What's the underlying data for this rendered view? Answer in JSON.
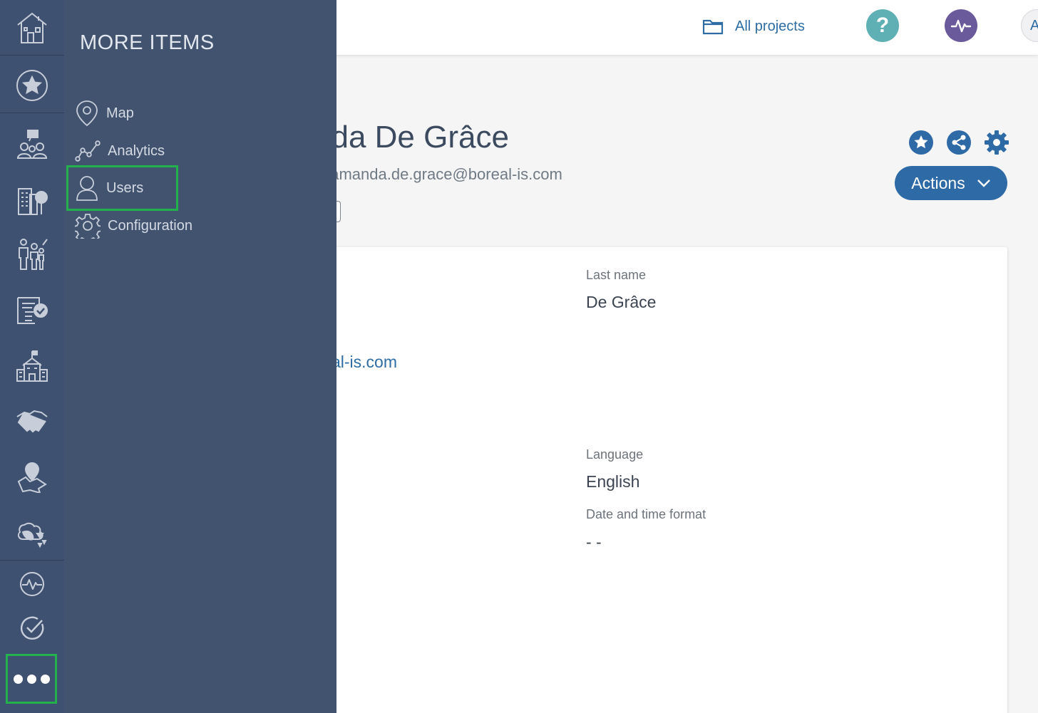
{
  "header": {
    "all_projects_label": "All projects",
    "help_symbol": "?",
    "avatar_initial": "A",
    "help_color": "#5fb0b4",
    "activity_color": "#6b5a9b"
  },
  "rail": {
    "items": [
      {
        "icon": "home-icon"
      },
      {
        "icon": "star-icon"
      },
      {
        "icon": "stakeholders-icon"
      },
      {
        "icon": "buildings-tree-icon"
      },
      {
        "icon": "family-icon"
      },
      {
        "icon": "checklist-icon"
      },
      {
        "icon": "school-icon"
      },
      {
        "icon": "handshake-icon"
      },
      {
        "icon": "land-pin-icon"
      },
      {
        "icon": "environment-icon"
      },
      {
        "icon": "activity-icon"
      },
      {
        "icon": "check-circle-icon"
      }
    ],
    "more_icon": "more-dots-icon",
    "background": "#3f5170"
  },
  "flyout": {
    "title": "MORE ITEMS",
    "items": [
      {
        "label": "Map",
        "icon": "map-pin-icon"
      },
      {
        "label": "Analytics",
        "icon": "analytics-icon"
      },
      {
        "label": "Users",
        "icon": "user-icon"
      },
      {
        "label": "Configuration",
        "icon": "gear-icon"
      }
    ],
    "background": "#42536f"
  },
  "profile": {
    "title_visible": "nda De Grâce",
    "subtitle_visible": "ceamanda.de.grace@boreal-is.com",
    "actions_label": "Actions",
    "accent_color": "#2e6aa5"
  },
  "details": {
    "last_name_label": "Last name",
    "last_name_value": "De Grâce",
    "email_visible": "al-is.com",
    "language_label": "Language",
    "language_value": "English",
    "datetime_label": "Date and time format",
    "datetime_value": "- -"
  },
  "highlight_color": "#22b14c"
}
